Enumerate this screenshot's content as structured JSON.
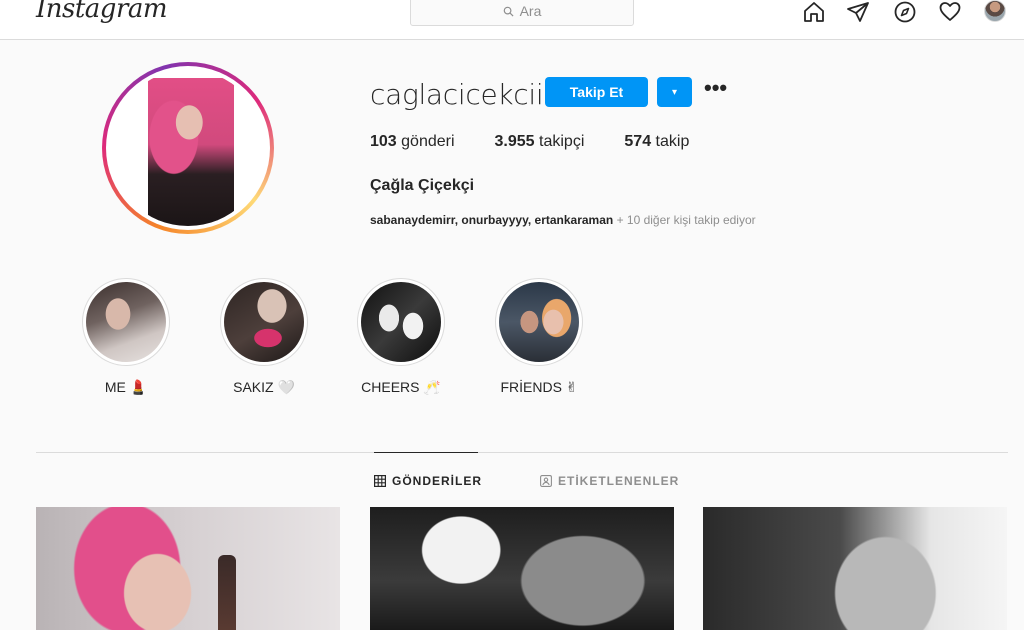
{
  "topbar": {
    "logo": "Instagram",
    "search_placeholder": "Ara"
  },
  "profile": {
    "username": "caglacicekciii",
    "follow_label": "Takip Et",
    "dropdown_glyph": "▾",
    "more_glyph": "•••",
    "stats": {
      "posts_count": "103",
      "posts_label": "gönderi",
      "followers_count": "3.955",
      "followers_label": "takipçi",
      "following_count": "574",
      "following_label": "takip"
    },
    "full_name": "Çağla Çiçekçi",
    "followed_by_names": "sabanaydemirr, onurbayyyy, ertankaraman",
    "followed_by_more": " + 10 diğer kişi takip ediyor"
  },
  "highlights": [
    {
      "label": "ME 💄"
    },
    {
      "label": "SAKIZ 🤍"
    },
    {
      "label": "CHEERS 🥂"
    },
    {
      "label": "FRİENDS ✌"
    }
  ],
  "tabs": {
    "posts": "GÖNDERİLER",
    "tagged": "ETİKETLENENLER"
  },
  "colors": {
    "accent": "#0095f6",
    "text": "#262626",
    "muted": "#8e8e8e",
    "border": "#dbdbdb"
  },
  "icons": [
    "home-icon",
    "direct-icon",
    "explore-icon",
    "heart-icon",
    "search-icon",
    "grid-icon",
    "tag-icon"
  ]
}
